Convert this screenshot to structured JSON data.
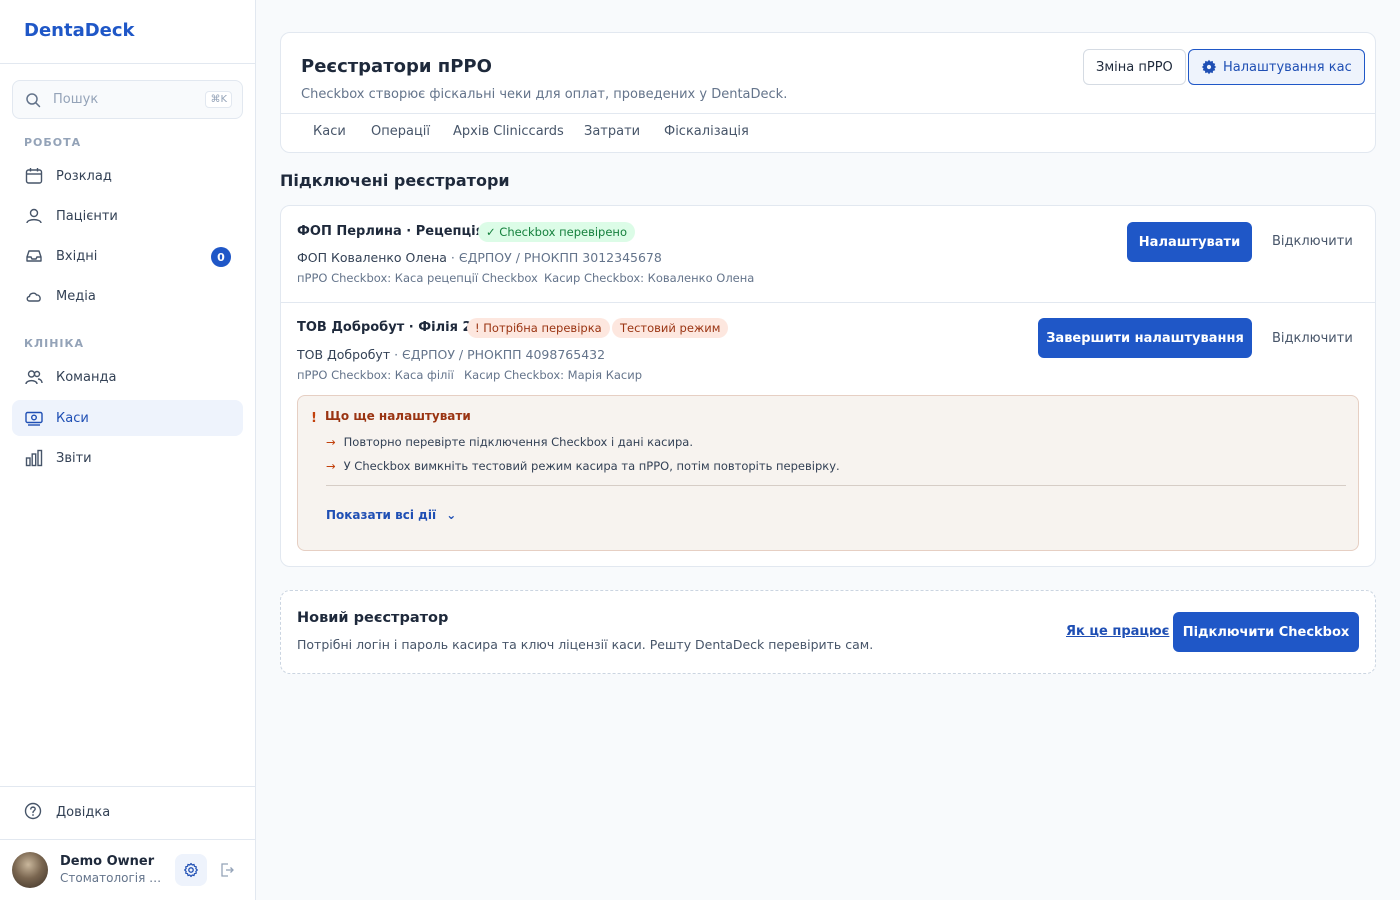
{
  "app": {
    "brand": "DentaDeck"
  },
  "sidebar": {
    "search": {
      "placeholder": "Пошук",
      "shortcut": "⌘K"
    },
    "sections": [
      {
        "label": "РОБОТА"
      },
      {
        "label": "КЛІНІКА"
      }
    ],
    "items": [
      {
        "label": "Розклад",
        "icon": "calendar-icon"
      },
      {
        "label": "Пацієнти",
        "icon": "users-icon"
      },
      {
        "label": "Вхідні",
        "icon": "inbox-icon",
        "badge": "0"
      },
      {
        "label": "Медіа",
        "icon": "cloud-icon"
      },
      {
        "label": "Команда",
        "icon": "team-icon"
      },
      {
        "label": "Каси",
        "icon": "cash-register-icon",
        "active": true
      },
      {
        "label": "Звіти",
        "icon": "bar-chart-icon"
      }
    ],
    "help": {
      "label": "Довідка",
      "icon": "help-circle-icon"
    },
    "user": {
      "name": "Demo Owner",
      "clinic": "Стоматологія П..."
    }
  },
  "header": {
    "title": "Реєстратори пРРО",
    "subtitle": "Checkbox створює фіскальні чеки для оплат, проведених у DentaDeck.",
    "buttons": {
      "change": "Зміна пРРО",
      "settings": "Налаштування кас"
    },
    "tabs": [
      "Каси",
      "Операції",
      "Архів Cliniccards",
      "Затрати",
      "Фіскалізація"
    ]
  },
  "registrars_section": {
    "title": "Підключені реєстратори",
    "items": [
      {
        "name": "ФОП Перлина · Рецепція",
        "badges": [
          "✓ Checkbox перевірено"
        ],
        "owner": "ФОП Коваленко Олена",
        "tax_id": "· ЄДРПОУ / РНОКПП 3012345678",
        "prro": "пРРО Checkbox: Каса рецепції Checkbox",
        "cashier": "Касир Checkbox: Коваленко Олена",
        "primary_action": "Налаштувати",
        "secondary_action": "Відключити"
      },
      {
        "name": "ТОВ Добробут · Філія 2",
        "badges": [
          "! Потрібна перевірка",
          "Тестовий режим"
        ],
        "owner": "ТОВ Добробут",
        "tax_id": "· ЄДРПОУ / РНОКПП 4098765432",
        "prro": "пРРО Checkbox: Каса філії",
        "cashier": "Касир Checkbox: Марія Касир",
        "primary_action": "Завершити налаштування",
        "secondary_action": "Відключити",
        "todo": {
          "mark": "!",
          "title": "Що ще налаштувати",
          "items": [
            "Повторно перевірте підключення Checkbox і дані касира.",
            "У Checkbox вимкніть тестовий режим касира та пРРО, потім повторіть перевірку."
          ],
          "show_all": "Показати всі дії"
        }
      }
    ]
  },
  "new_registrar": {
    "title": "Новий реєстратор",
    "description": "Потрібні логін і пароль касира та ключ ліцензії каси. Решту DentaDeck перевірить сам.",
    "how_link": "Як це працює",
    "connect_button": "Підключити Checkbox"
  },
  "colors": {
    "brand": "#1f57c7",
    "success_bg": "#dcfce7",
    "success_text": "#15803d",
    "warning_bg": "#fde7df",
    "warning_text": "#9a3412"
  }
}
